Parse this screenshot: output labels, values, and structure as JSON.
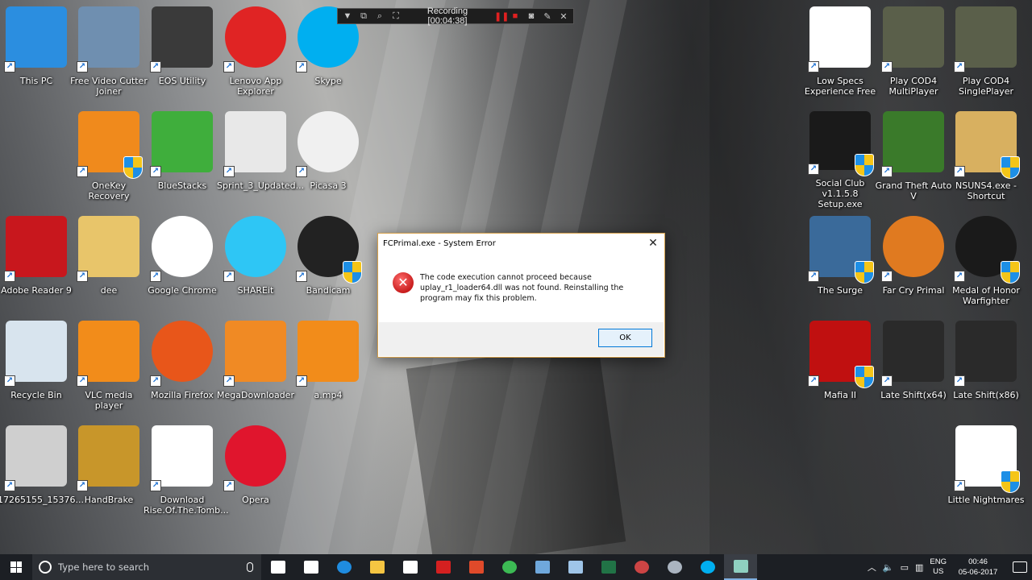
{
  "recording_toolbar": {
    "status_text": "Recording [00:04:38]"
  },
  "desktop_left": [
    {
      "label": "This PC",
      "icon": "computer-icon",
      "color": "#2b8ee0"
    },
    {
      "label": "Free Video Cutter Joiner",
      "icon": "scissors-icon",
      "color": "#6f8fb0"
    },
    {
      "label": "EOS Utility",
      "icon": "camera-icon",
      "color": "#3a3a3a"
    },
    {
      "label": "Lenovo App Explorer",
      "icon": "compass-icon",
      "color": "#e02424"
    },
    {
      "label": "Skype",
      "icon": "skype-icon",
      "color": "#00aff0"
    },
    {
      "label": "OneKey Recovery",
      "icon": "download-arrow-icon",
      "color": "#f08a1c"
    },
    {
      "label": "BlueStacks",
      "icon": "layers-icon",
      "color": "#3fae3c"
    },
    {
      "label": "Sprint_3_Updated...",
      "icon": "excel-file-icon",
      "color": "#e8e8e8"
    },
    {
      "label": "Picasa 3",
      "icon": "picasa-icon",
      "color": "#f0f0f0"
    },
    {
      "label": "Adobe Reader 9",
      "icon": "pdf-icon",
      "color": "#c8171d"
    },
    {
      "label": "dee",
      "icon": "folder-icon",
      "color": "#e8c56a"
    },
    {
      "label": "Google Chrome",
      "icon": "chrome-icon",
      "color": "#ffffff"
    },
    {
      "label": "SHAREit",
      "icon": "shareit-icon",
      "color": "#2ec6f5"
    },
    {
      "label": "Bandicam",
      "icon": "record-icon",
      "color": "#222222"
    },
    {
      "label": "Recycle Bin",
      "icon": "recycle-bin-icon",
      "color": "#d8e4ee"
    },
    {
      "label": "VLC media player",
      "icon": "vlc-cone-icon",
      "color": "#f28c1a"
    },
    {
      "label": "Mozilla Firefox",
      "icon": "firefox-icon",
      "color": "#e8561a"
    },
    {
      "label": "MegaDownloader",
      "icon": "cloud-m-icon",
      "color": "#f08a24"
    },
    {
      "label": "a.mp4",
      "icon": "vlc-cone-icon",
      "color": "#f28c1a"
    },
    {
      "label": "17265155_15376...",
      "icon": "image-thumbnail-icon",
      "color": "#cfcfcf"
    },
    {
      "label": "HandBrake",
      "icon": "pineapple-icon",
      "color": "#c8962a"
    },
    {
      "label": "Download Rise.Of.The.Tomb...",
      "icon": "edge-file-icon",
      "color": "#ffffff"
    },
    {
      "label": "Opera",
      "icon": "opera-icon",
      "color": "#e0152d"
    }
  ],
  "desktop_right": [
    {
      "label": "Low Specs Experience Free",
      "icon": "lse-logo-icon",
      "color": "#ffffff"
    },
    {
      "label": "Play COD4 MultiPlayer",
      "icon": "cod4-icon",
      "color": "#5a5f4a"
    },
    {
      "label": "Play COD4 SinglePlayer",
      "icon": "cod4-icon",
      "color": "#5a5f4a"
    },
    {
      "label": "Social Club v1.1.5.8 Setup.exe",
      "icon": "social-club-icon",
      "color": "#1a1a1a"
    },
    {
      "label": "Grand Theft Auto V",
      "icon": "gta-v-icon",
      "color": "#3a7a2a"
    },
    {
      "label": "NSUNS4.exe - Shortcut",
      "icon": "naruto-leaf-icon",
      "color": "#d8b060"
    },
    {
      "label": "The Surge",
      "icon": "surge-icon",
      "color": "#3a6a9a"
    },
    {
      "label": "Far Cry Primal",
      "icon": "far-cry-primal-icon",
      "color": "#e07a20"
    },
    {
      "label": "Medal of Honor Warfighter",
      "icon": "moh-icon",
      "color": "#1a1a1a"
    },
    {
      "label": "Mafia II",
      "icon": "mafia-icon",
      "color": "#c01010"
    },
    {
      "label": "Late Shift(x64)",
      "icon": "late-shift-icon",
      "color": "#2a2a2a"
    },
    {
      "label": "Late Shift(x86)",
      "icon": "late-shift-icon",
      "color": "#2a2a2a"
    },
    {
      "label": "Little Nightmares",
      "icon": "eye-icon",
      "color": "#ffffff"
    }
  ],
  "dialog": {
    "title": "FCPrimal.exe - System Error",
    "message": "The code execution cannot proceed because uplay_r1_loader64.dll was not found. Reinstalling the program may fix this problem.",
    "ok_label": "OK"
  },
  "taskbar": {
    "search_placeholder": "Type here to search",
    "apps": [
      {
        "icon": "task-view-icon",
        "color": "#ffffff"
      },
      {
        "icon": "mail-icon",
        "color": "#ffffff"
      },
      {
        "icon": "edge-icon",
        "color": "#1f8ce0"
      },
      {
        "icon": "file-explorer-icon",
        "color": "#f5c542"
      },
      {
        "icon": "store-icon",
        "color": "#ffffff"
      },
      {
        "icon": "reader-icon",
        "color": "#d42020"
      },
      {
        "icon": "pdf-reader-icon",
        "color": "#e04a2a"
      },
      {
        "icon": "chrome-icon",
        "color": "#3cba54"
      },
      {
        "icon": "video-editor-icon",
        "color": "#6fa8dc"
      },
      {
        "icon": "notepad-icon",
        "color": "#9fc5e8"
      },
      {
        "icon": "excel-icon",
        "color": "#217346"
      },
      {
        "icon": "game-icon",
        "color": "#cc4444"
      },
      {
        "icon": "network-tool-icon",
        "color": "#aab4c0"
      },
      {
        "icon": "skype-icon",
        "color": "#00aff0"
      },
      {
        "icon": "active-window-icon",
        "color": "#8fd0c0"
      }
    ],
    "language_top": "ENG",
    "language_bottom": "US",
    "time": "00:46",
    "date": "05-06-2017"
  }
}
